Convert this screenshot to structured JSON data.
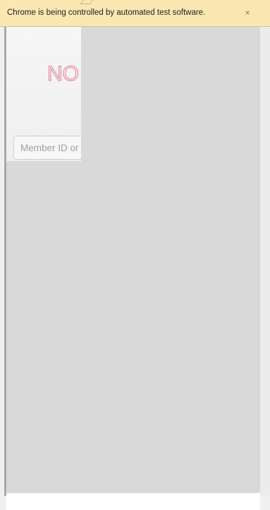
{
  "infobar": {
    "message": "Chrome is being controlled by automated test software.",
    "close_glyph": "×",
    "background": "#fbe7b1"
  },
  "page": {
    "logo_text": "NO",
    "logo_color": "#e07a8a",
    "member_input": {
      "placeholder": "Member ID or",
      "value": ""
    },
    "overlay_color": "#d9d9d9"
  }
}
